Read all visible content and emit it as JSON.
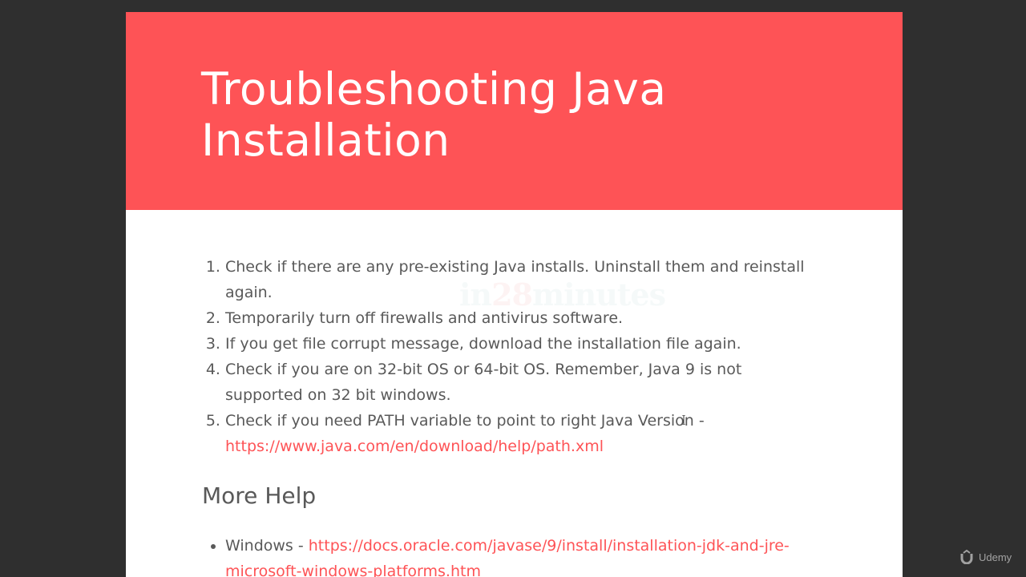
{
  "slide": {
    "title": "Troubleshooting Java Installation",
    "watermark_prefix": "in",
    "watermark_number": "28",
    "watermark_suffix": "minutes",
    "steps": [
      {
        "text": "Check if there are any pre-existing Java installs. Uninstall them and reinstall again."
      },
      {
        "text": "Temporarily turn off firewalls and antivirus software."
      },
      {
        "text": "If you get file corrupt message, download the installation file again."
      },
      {
        "text": "Check if you are on 32-bit OS or 64-bit OS. Remember, Java 9 is not supported on 32 bit windows."
      },
      {
        "text": "Check if you need PATH variable to point to right Java Version - ",
        "link": "https://www.java.com/en/download/help/path.xml"
      }
    ],
    "more_help_heading": "More Help",
    "help_items": [
      {
        "text": "Windows - ",
        "link": "https://docs.oracle.com/javase/9/install/installation-jdk-and-jre-microsoft-windows-platforms.htm"
      }
    ]
  },
  "brand": {
    "name": "Udemy"
  },
  "colors": {
    "banner": "#fe5356",
    "link": "#fe5356",
    "body_text": "#595959",
    "frame": "#2f2f2f"
  }
}
